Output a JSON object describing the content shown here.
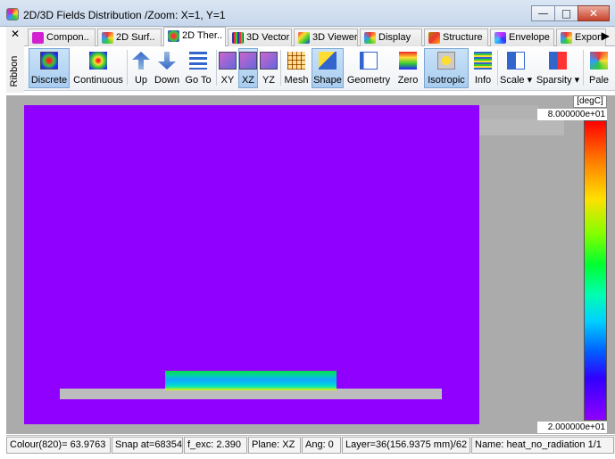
{
  "window": {
    "title": "2D/3D Fields Distribution /Zoom: X=1, Y=1",
    "minimize_glyph": "—",
    "maximize_glyph": "□",
    "close_glyph": "✕"
  },
  "ribbon": {
    "close_glyph": "✕",
    "label": "Ribbon"
  },
  "tabs": [
    {
      "label": "Compon..",
      "icon": "components-icon"
    },
    {
      "label": "2D Surf..",
      "icon": "surface-2d-icon"
    },
    {
      "label": "2D Ther..",
      "icon": "thermal-2d-icon",
      "active": true
    },
    {
      "label": "3D Vector",
      "icon": "vector-3d-icon"
    },
    {
      "label": "3D Viewer",
      "icon": "viewer-3d-icon"
    },
    {
      "label": "Display",
      "icon": "display-icon"
    },
    {
      "label": "Structure",
      "icon": "structure-icon"
    },
    {
      "label": "Envelope",
      "icon": "envelope-icon"
    },
    {
      "label": "Export",
      "icon": "export-icon"
    }
  ],
  "tab_more_glyph": "▶",
  "toolbar": [
    {
      "label": "Discrete",
      "icon": "discrete-icon",
      "active": true
    },
    {
      "label": "Continuous",
      "icon": "continuous-icon"
    },
    {
      "label": "Up",
      "icon": "arrow-up-icon"
    },
    {
      "label": "Down",
      "icon": "arrow-down-icon"
    },
    {
      "label": "Go To",
      "icon": "goto-icon"
    },
    {
      "label": "XY",
      "icon": "plane-xy-icon"
    },
    {
      "label": "XZ",
      "icon": "plane-xz-icon",
      "active": true
    },
    {
      "label": "YZ",
      "icon": "plane-yz-icon"
    },
    {
      "label": "Mesh",
      "icon": "mesh-icon"
    },
    {
      "label": "Shape",
      "icon": "shape-icon",
      "active": true
    },
    {
      "label": "Geometry",
      "icon": "geometry-icon"
    },
    {
      "label": "Zero",
      "icon": "zero-icon"
    },
    {
      "label": "Isotropic",
      "icon": "isotropic-icon",
      "active": true
    },
    {
      "label": "Info",
      "icon": "info-icon"
    },
    {
      "label": "Scale",
      "icon": "scale-icon"
    },
    {
      "label": "Sparsity",
      "icon": "sparsity-icon"
    },
    {
      "label": "Pale",
      "icon": "palette-icon"
    }
  ],
  "plot": {
    "unit": "[degC]",
    "scale_max": "8.000000e+01",
    "scale_min": "2.000000e+01",
    "colors": {
      "field": "#8f00ff",
      "substrate": "#bdbdbd",
      "background": "#ababab"
    }
  },
  "status": {
    "colour": "Colour(820)= 63.9763",
    "snap": "Snap at=68354",
    "f_exc": "f_exc:  2.390",
    "plane": "Plane: XZ",
    "ang": "Ang:   0",
    "layer": "Layer=36(156.9375 mm)/62",
    "name": "Name: heat_no_radiation 1/1"
  }
}
